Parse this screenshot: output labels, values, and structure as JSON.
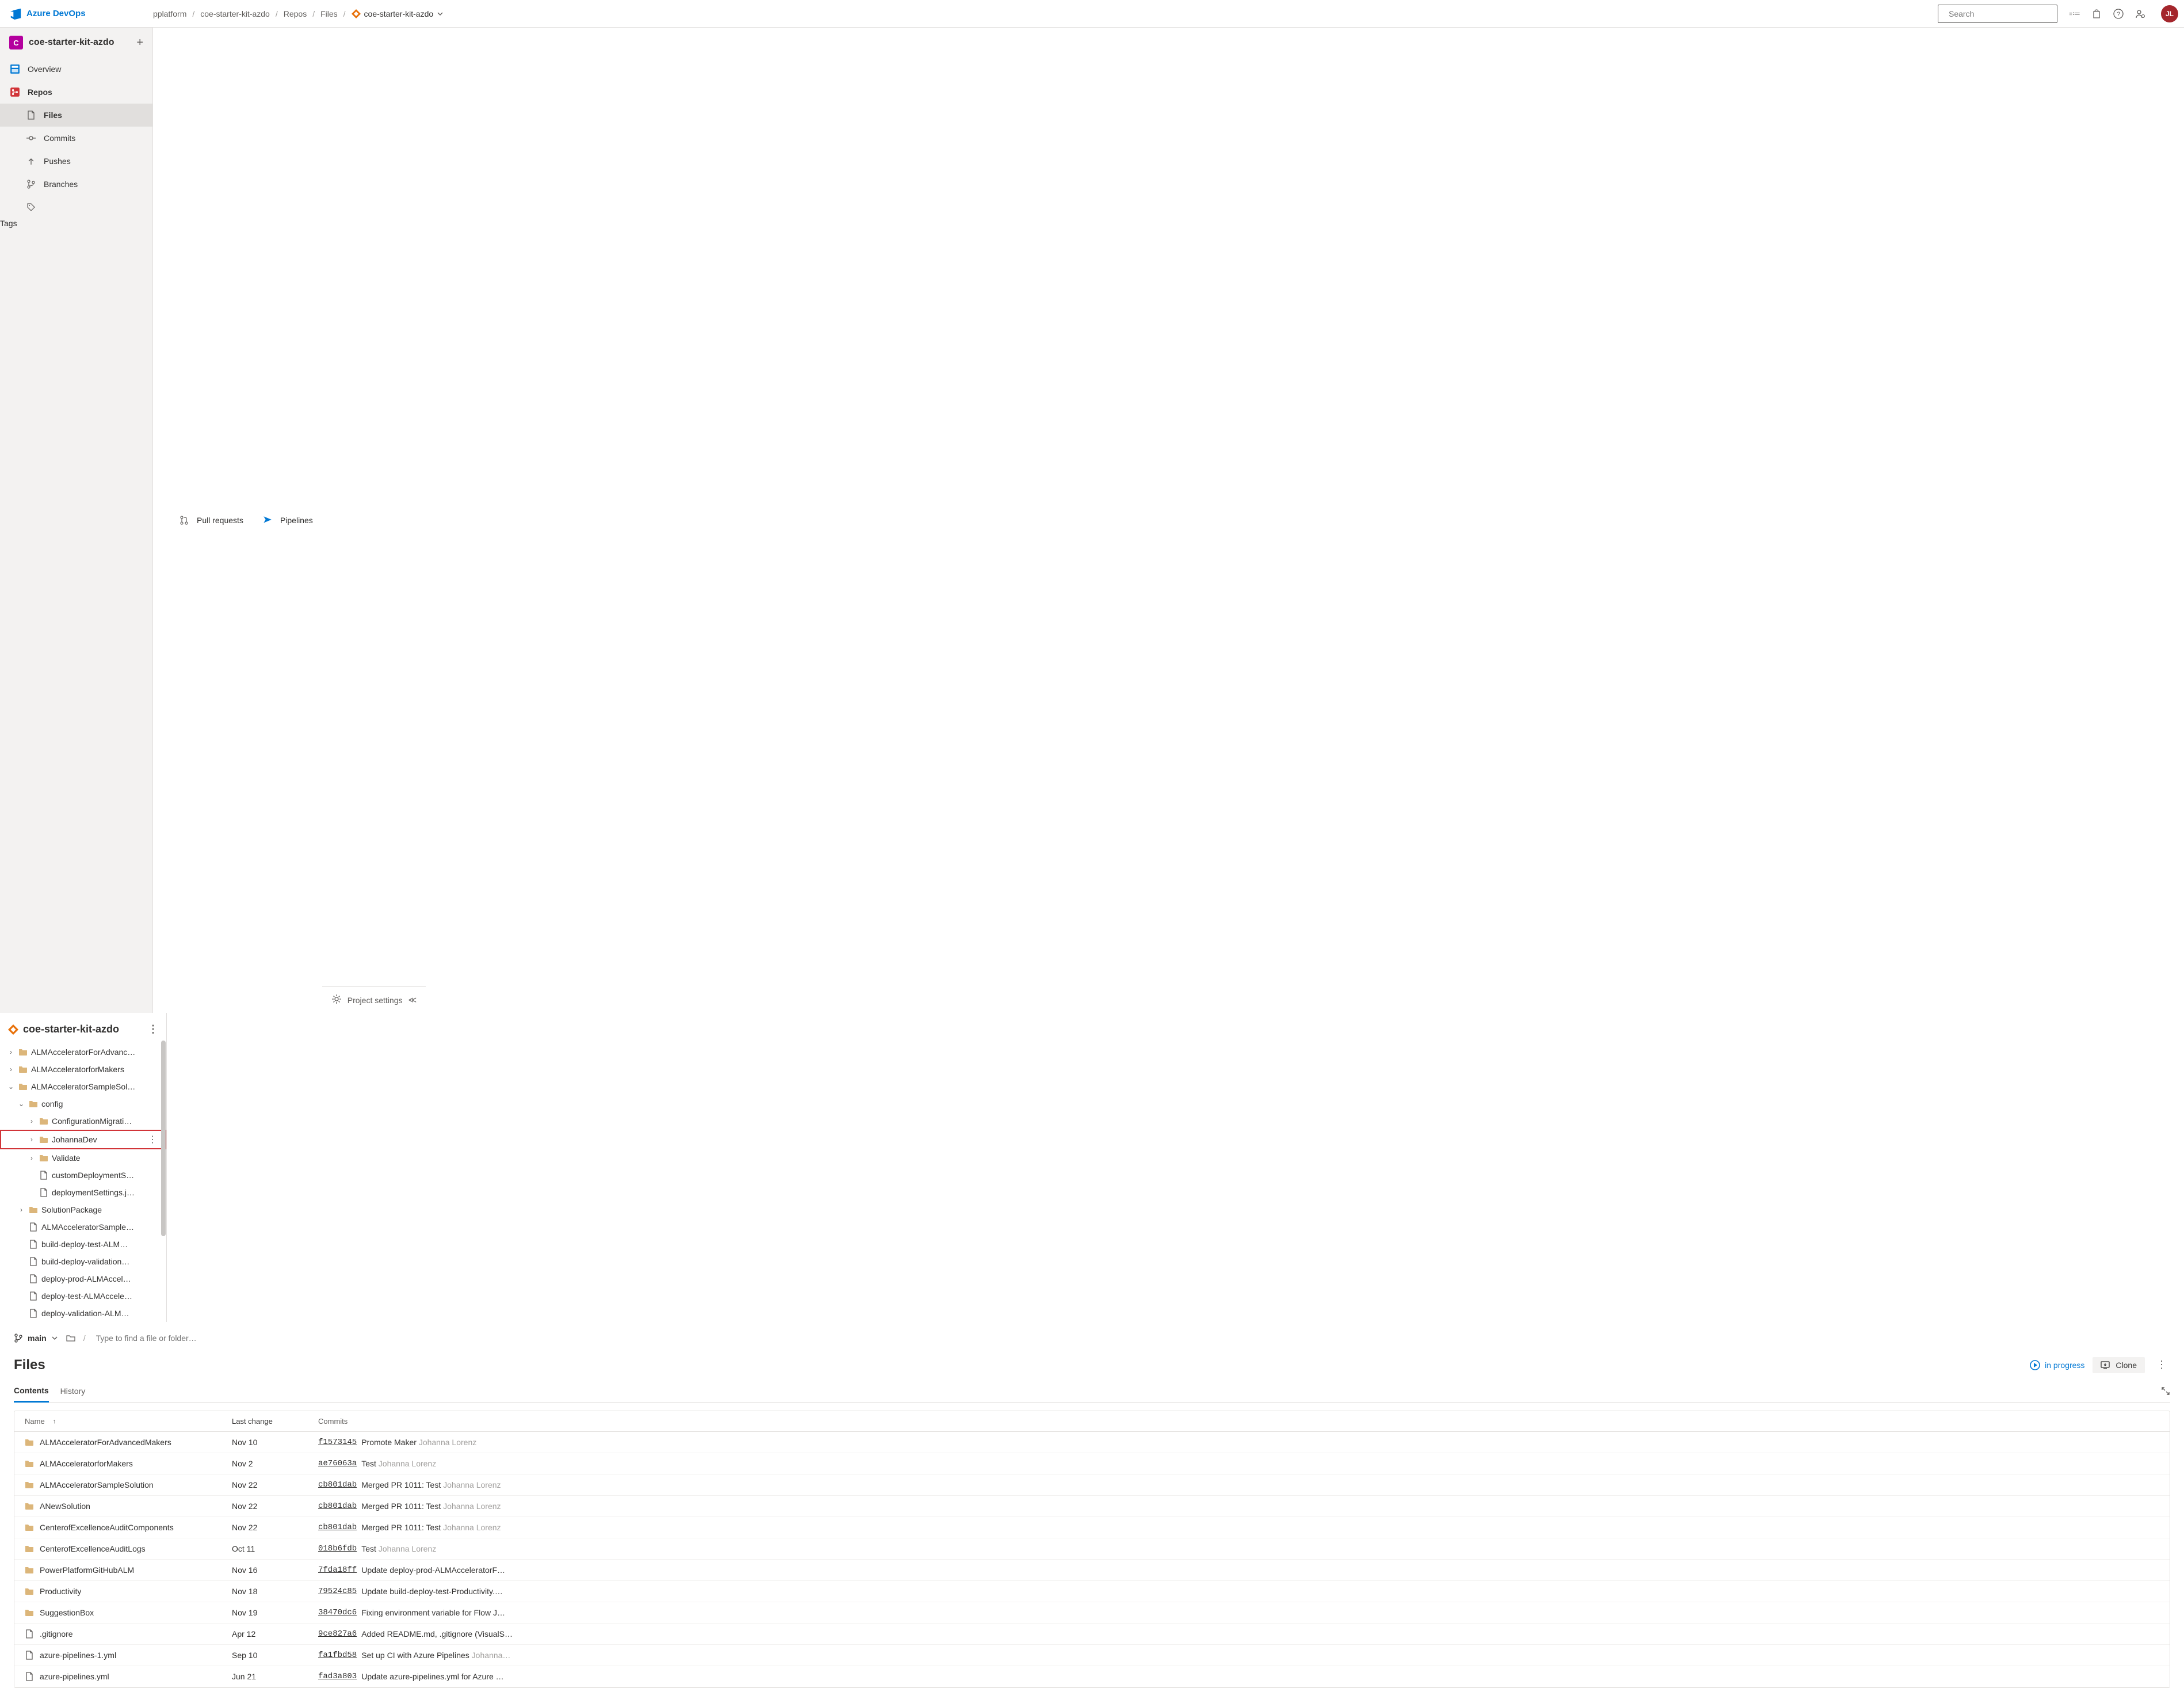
{
  "brand": "Azure DevOps",
  "breadcrumb": {
    "org": "pplatform",
    "project": "coe-starter-kit-azdo",
    "area": "Repos",
    "sub": "Files",
    "repo": "coe-starter-kit-azdo"
  },
  "search": {
    "placeholder": "Search"
  },
  "user": {
    "initials": "JL"
  },
  "project": {
    "badge": "C",
    "name": "coe-starter-kit-azdo"
  },
  "nav": {
    "overview": "Overview",
    "repos": "Repos",
    "files": "Files",
    "commits": "Commits",
    "pushes": "Pushes",
    "branches": "Branches",
    "tags": "Tags",
    "pull_requests": "Pull requests",
    "pipelines": "Pipelines",
    "project_settings": "Project settings"
  },
  "tree": {
    "repo": "coe-starter-kit-azdo",
    "items": [
      {
        "label": "ALMAcceleratorForAdvanc…",
        "type": "folder",
        "depth": 0,
        "chev": "right"
      },
      {
        "label": "ALMAcceleratorforMakers",
        "type": "folder",
        "depth": 0,
        "chev": "right"
      },
      {
        "label": "ALMAcceleratorSampleSol…",
        "type": "folder",
        "depth": 0,
        "chev": "down"
      },
      {
        "label": "config",
        "type": "folder",
        "depth": 1,
        "chev": "down"
      },
      {
        "label": "ConfigurationMigrati…",
        "type": "folder",
        "depth": 2,
        "chev": "right"
      },
      {
        "label": "JohannaDev",
        "type": "folder",
        "depth": 2,
        "chev": "right",
        "highlighted": true,
        "more": true
      },
      {
        "label": "Validate",
        "type": "folder",
        "depth": 2,
        "chev": "right"
      },
      {
        "label": "customDeploymentS…",
        "type": "file",
        "depth": 2
      },
      {
        "label": "deploymentSettings.j…",
        "type": "file",
        "depth": 2
      },
      {
        "label": "SolutionPackage",
        "type": "folder",
        "depth": 1,
        "chev": "right"
      },
      {
        "label": "ALMAcceleratorSample…",
        "type": "file",
        "depth": 1
      },
      {
        "label": "build-deploy-test-ALM…",
        "type": "file",
        "depth": 1
      },
      {
        "label": "build-deploy-validation…",
        "type": "file",
        "depth": 1
      },
      {
        "label": "deploy-prod-ALMAccel…",
        "type": "file",
        "depth": 1
      },
      {
        "label": "deploy-test-ALMAccele…",
        "type": "file",
        "depth": 1
      },
      {
        "label": "deploy-validation-ALM…",
        "type": "file",
        "depth": 1
      }
    ]
  },
  "branch": {
    "name": "main"
  },
  "path_placeholder": "Type to find a file or folder…",
  "page_title": "Files",
  "progress_label": "in progress",
  "clone_label": "Clone",
  "tabs": {
    "contents": "Contents",
    "history": "History"
  },
  "table": {
    "head": {
      "name": "Name",
      "last_change": "Last change",
      "commits": "Commits"
    },
    "rows": [
      {
        "type": "folder",
        "name": "ALMAcceleratorForAdvancedMakers",
        "date": "Nov 10",
        "hash": "f1573145",
        "msg": "Promote Maker",
        "author": "Johanna Lorenz"
      },
      {
        "type": "folder",
        "name": "ALMAcceleratorforMakers",
        "date": "Nov 2",
        "hash": "ae76063a",
        "msg": "Test",
        "author": "Johanna Lorenz"
      },
      {
        "type": "folder",
        "name": "ALMAcceleratorSampleSolution",
        "date": "Nov 22",
        "hash": "cb801dab",
        "msg": "Merged PR 1011: Test",
        "author": "Johanna Lorenz"
      },
      {
        "type": "folder",
        "name": "ANewSolution",
        "date": "Nov 22",
        "hash": "cb801dab",
        "msg": "Merged PR 1011: Test",
        "author": "Johanna Lorenz"
      },
      {
        "type": "folder",
        "name": "CenterofExcellenceAuditComponents",
        "date": "Nov 22",
        "hash": "cb801dab",
        "msg": "Merged PR 1011: Test",
        "author": "Johanna Lorenz"
      },
      {
        "type": "folder",
        "name": "CenterofExcellenceAuditLogs",
        "date": "Oct 11",
        "hash": "018b6fdb",
        "msg": "Test",
        "author": "Johanna Lorenz"
      },
      {
        "type": "folder",
        "name": "PowerPlatformGitHubALM",
        "date": "Nov 16",
        "hash": "7fda18ff",
        "msg": "Update deploy-prod-ALMAcceleratorF…",
        "author": ""
      },
      {
        "type": "folder",
        "name": "Productivity",
        "date": "Nov 18",
        "hash": "79524c85",
        "msg": "Update build-deploy-test-Productivity.…",
        "author": ""
      },
      {
        "type": "folder",
        "name": "SuggestionBox",
        "date": "Nov 19",
        "hash": "38470dc6",
        "msg": "Fixing environment variable for Flow J…",
        "author": ""
      },
      {
        "type": "file",
        "name": ".gitignore",
        "date": "Apr 12",
        "hash": "9ce827a6",
        "msg": "Added README.md, .gitignore (VisualS…",
        "author": ""
      },
      {
        "type": "file",
        "name": "azure-pipelines-1.yml",
        "date": "Sep 10",
        "hash": "fa1fbd58",
        "msg": "Set up CI with Azure Pipelines",
        "author": "Johanna…"
      },
      {
        "type": "file",
        "name": "azure-pipelines.yml",
        "date": "Jun 21",
        "hash": "fad3a803",
        "msg": "Update azure-pipelines.yml for Azure …",
        "author": ""
      }
    ]
  }
}
